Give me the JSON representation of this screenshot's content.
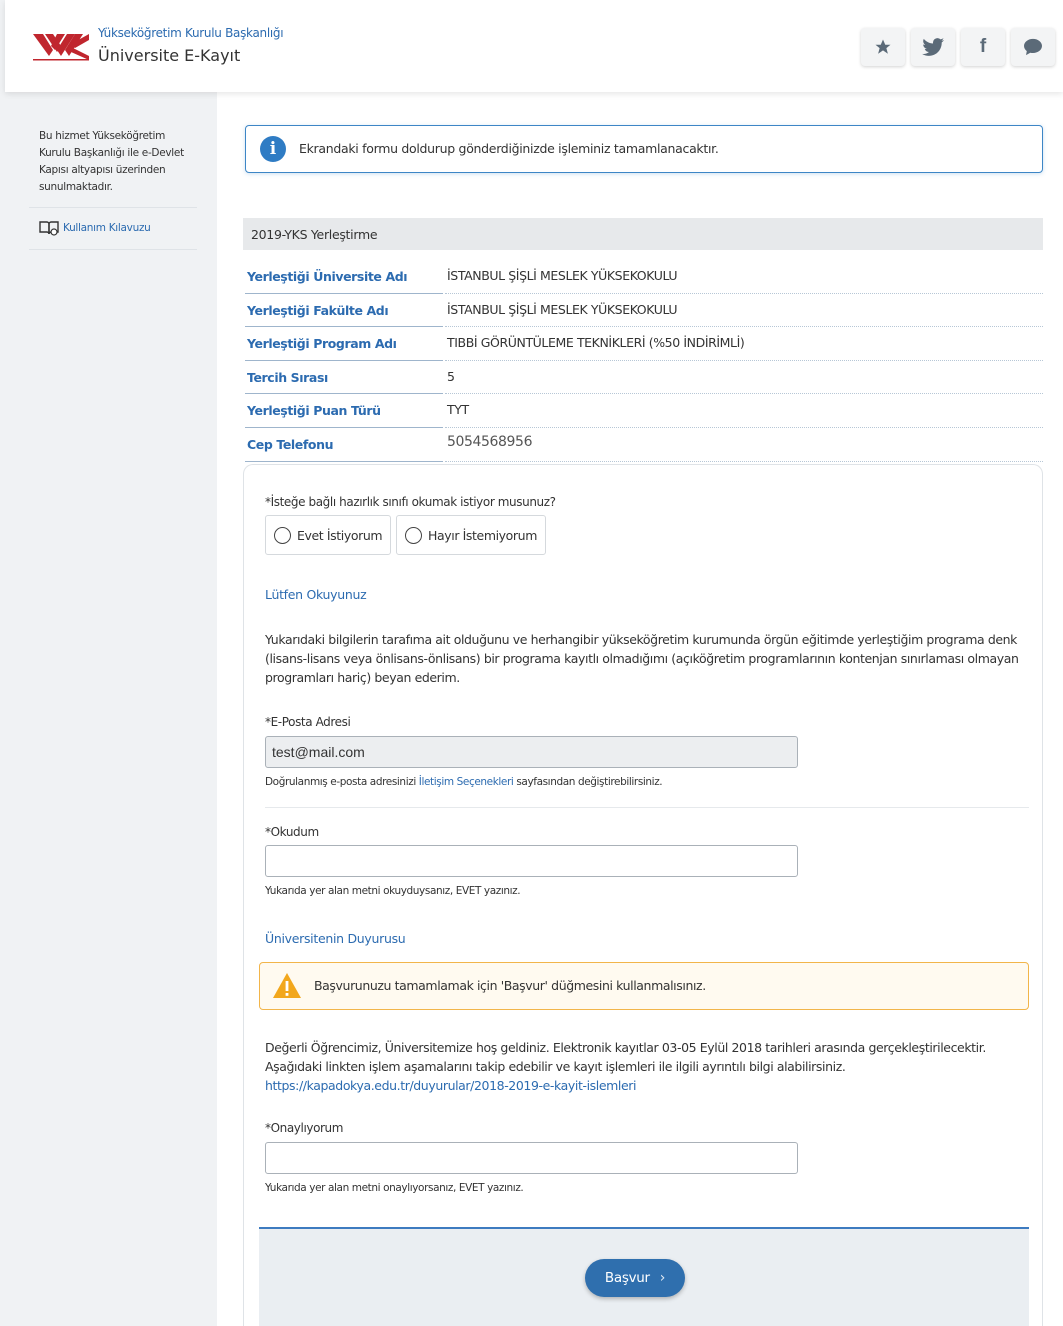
{
  "header": {
    "subtitle": "Yükseköğretim Kurulu Başkanlığı",
    "title": "Üniversite E-Kayıt",
    "actions": [
      {
        "name": "favorite",
        "icon": "star-icon",
        "glyph": "★"
      },
      {
        "name": "twitter",
        "icon": "twitter-icon",
        "glyph": "🐦"
      },
      {
        "name": "facebook",
        "icon": "facebook-icon",
        "glyph": "f"
      },
      {
        "name": "comment",
        "icon": "comment-icon",
        "glyph": "💬"
      }
    ]
  },
  "sidebar": {
    "description": "Bu hizmet Yükseköğretim Kurulu Başkanlığı ile e-Devlet Kapısı altyapısı üzerinden sunulmaktadır.",
    "guide_link": "Kullanım Kılavuzu"
  },
  "info": {
    "message": "Ekrandaki formu doldurup gönderdiğinizde işleminiz tamamlanacaktır."
  },
  "placement": {
    "section_title": "2019-YKS Yerleştirme",
    "rows": [
      {
        "label": "Yerleştiği Üniversite Adı",
        "value": "İSTANBUL ŞİŞLİ MESLEK YÜKSEKOKULU"
      },
      {
        "label": "Yerleştiği Fakülte Adı",
        "value": "İSTANBUL ŞİŞLİ MESLEK YÜKSEKOKULU"
      },
      {
        "label": "Yerleştiği Program Adı",
        "value": "TIBBİ GÖRÜNTÜLEME TEKNİKLERİ (%50 İNDİRİMLİ)"
      },
      {
        "label": "Tercih Sırası",
        "value": "5"
      },
      {
        "label": "Yerleştiği Puan Türü",
        "value": "TYT"
      },
      {
        "label": "Cep Telefonu",
        "value": "5054568956"
      }
    ]
  },
  "form": {
    "prep_question": "*İsteğe bağlı hazırlık sınıfı okumak istiyor musunuz?",
    "option_yes": "Evet İstiyorum",
    "option_no": "Hayır İstemiyorum",
    "read_title": "Lütfen Okuyunuz",
    "declaration": "Yukarıdaki bilgilerin tarafıma ait olduğunu ve herhangibir yükseköğretim kurumunda örgün eğitimde yerleştiğim programa denk (lisans-lisans veya önlisans-önlisans) bir programa kayıtlı olmadığımı (açıköğretim programlarının kontenjan sınırlaması olmayan programları hariç) beyan ederim.",
    "email_label": "*E-Posta Adresi",
    "email_value": "test@mail.com",
    "email_help_prefix": "Doğrulanmış e-posta adresinizi ",
    "email_help_link": "İletişim Seçenekleri",
    "email_help_suffix": " sayfasından değiştirebilirsiniz.",
    "read_label": "*Okudum",
    "read_value": "",
    "read_help": "Yukarıda yer alan metni okuyduysanız, EVET yazınız.",
    "announcement_title": "Üniversitenin Duyurusu",
    "warning": "Başvurunuzu tamamlamak için 'Başvur' düğmesini kullanmalısınız.",
    "announcement": "Değerli Öğrencimiz, Üniversitemize hoş geldiniz. Elektronik kayıtlar 03-05 Eylül 2018 tarihleri arasında gerçekleştirilecektir. Aşağıdaki linkten işlem aşamalarını takip edebilir ve kayıt işlemleri ile ilgili ayrıntılı bilgi alabilirsiniz.",
    "announcement_link": "https://kapadokya.edu.tr/duyurular/2018-2019-e-kayit-islemleri",
    "confirm_label": "*Onaylıyorum",
    "confirm_value": "",
    "confirm_help": "Yukarıda yer alan metni onaylıyorsanız, EVET yazınız.",
    "submit_label": "Başvur",
    "submit_chevron": "›"
  },
  "colors": {
    "brand_blue": "#2c6bb0",
    "logo_red": "#c0262e",
    "warning": "#f2b54a",
    "button": "#2f6fae"
  }
}
